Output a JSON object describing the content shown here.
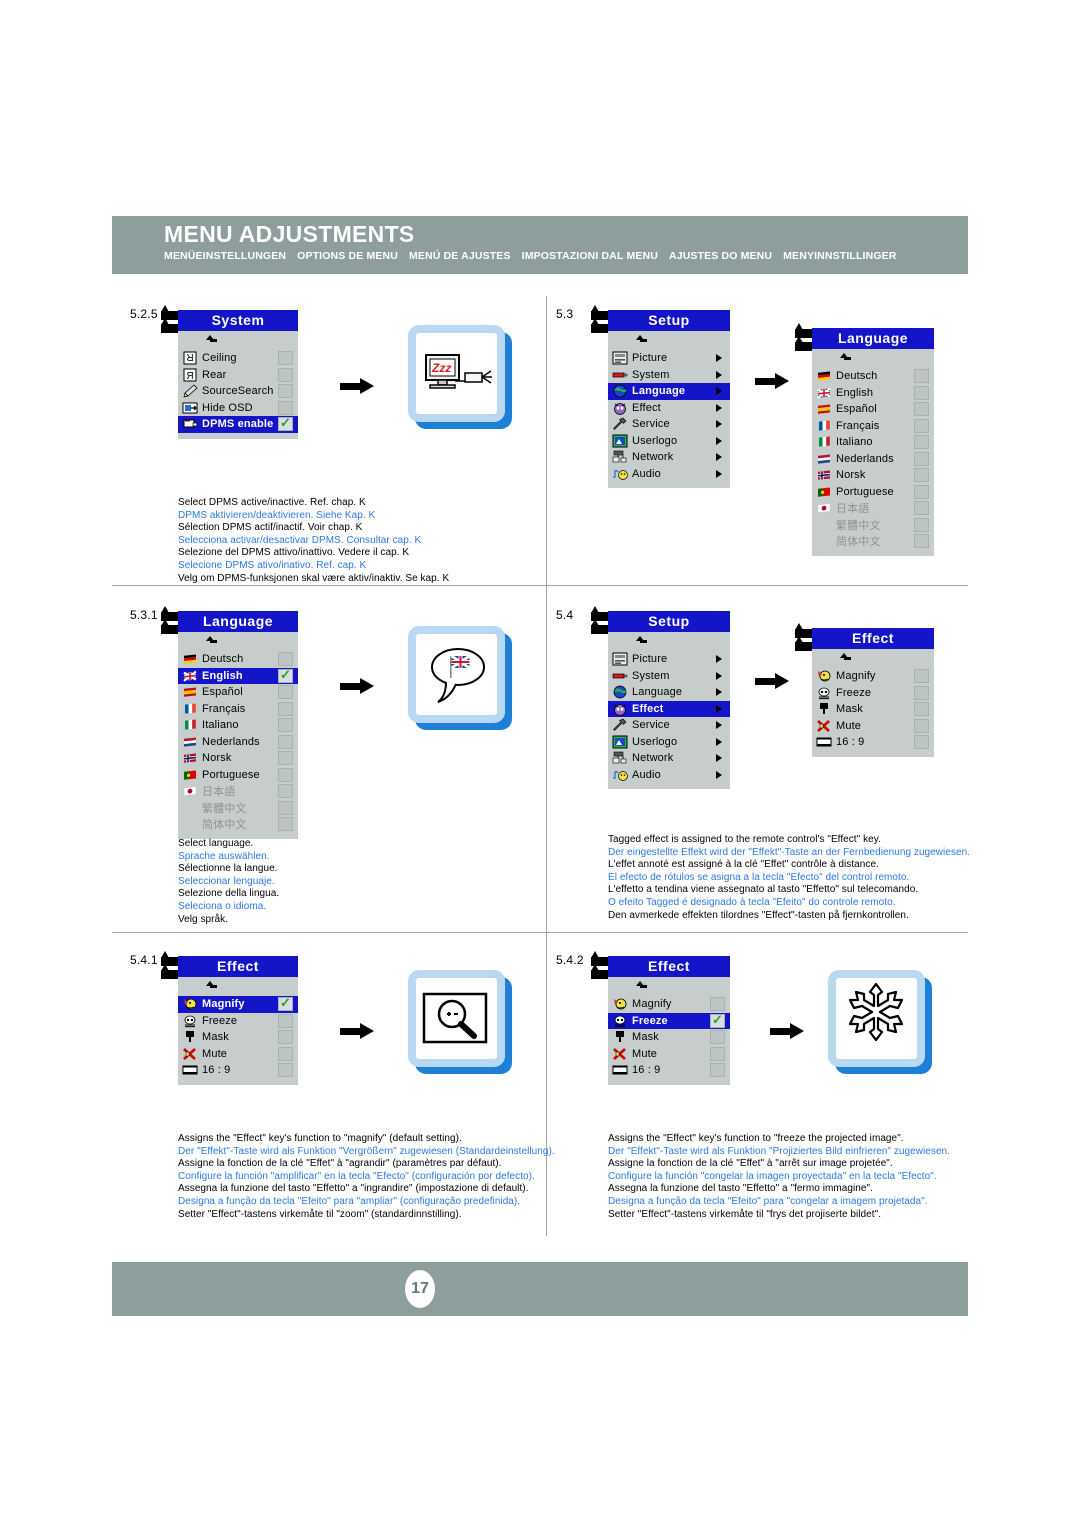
{
  "header": {
    "title": "MENU ADJUSTMENTS",
    "subtitles": [
      "MENÜEINSTELLUNGEN",
      "OPTIONS DE MENU",
      "MENÚ DE AJUSTES",
      "IMPOSTAZIONI DAL MENU",
      "AJUSTES DO MENU",
      "MENYINNSTILLINGER"
    ]
  },
  "footer": {
    "page": "17"
  },
  "colors": {
    "header_bg": "#8d9e9c",
    "osd_title_bg": "#1414c8",
    "osd_body_bg": "#c7cdcd",
    "highlight": "#1414c8",
    "check_green": "#2aa02a",
    "caption_alt": "#2b7ae0",
    "illu_frame": "#b9d9f2",
    "illu_shadow": "#1e7fd6"
  },
  "sections": [
    {
      "number": "5.2.5",
      "menu": {
        "title": "System",
        "items": [
          {
            "label": "Ceiling",
            "icon": "ceiling-icon",
            "selected": false,
            "checked": false
          },
          {
            "label": "Rear",
            "icon": "rear-icon",
            "selected": false,
            "checked": false
          },
          {
            "label": "SourceSearch",
            "icon": "sourcesearch-icon",
            "selected": false,
            "checked": false
          },
          {
            "label": "Hide OSD",
            "icon": "hide-osd-icon",
            "selected": false,
            "checked": false
          },
          {
            "label": "DPMS enable",
            "icon": "dpms-icon",
            "selected": true,
            "checked": true
          }
        ]
      },
      "illustration": "monitor-sleep-zzz",
      "caption": [
        {
          "text": "Select DPMS active/inactive. Ref. chap. K",
          "alt": false
        },
        {
          "text": "DPMS aktivieren/deaktivieren. Siehe Kap. K",
          "alt": true
        },
        {
          "text": "Sélection DPMS actif/inactif. Voir chap. K",
          "alt": false
        },
        {
          "text": "Selecciona activar/desactivar DPMS. Consultar cap. K",
          "alt": true
        },
        {
          "text": "Selezione del DPMS attivo/inattivo. Vedere il cap. K",
          "alt": false
        },
        {
          "text": "Selecione DPMS ativo/inativo. Ref. cap. K",
          "alt": true
        },
        {
          "text": "Velg om DPMS-funksjonen skal være aktiv/inaktiv. Se kap. K",
          "alt": false
        }
      ]
    },
    {
      "number": "5.3",
      "menu": {
        "title": "Setup",
        "items": [
          {
            "label": "Picture",
            "icon": "picture-icon",
            "selected": false,
            "submenu": true
          },
          {
            "label": "System",
            "icon": "system-icon",
            "selected": false,
            "submenu": true
          },
          {
            "label": "Language",
            "icon": "language-icon",
            "selected": true,
            "submenu": true
          },
          {
            "label": "Effect",
            "icon": "effect-icon",
            "selected": false,
            "submenu": true
          },
          {
            "label": "Service",
            "icon": "service-icon",
            "selected": false,
            "submenu": true
          },
          {
            "label": "Userlogo",
            "icon": "userlogo-icon",
            "selected": false,
            "submenu": true
          },
          {
            "label": "Network",
            "icon": "network-icon",
            "selected": false,
            "submenu": true
          },
          {
            "label": "Audio",
            "icon": "audio-icon",
            "selected": false,
            "submenu": true
          }
        ]
      },
      "submenu": {
        "title": "Language",
        "items": [
          {
            "label": "Deutsch",
            "icon": "flag-de",
            "selected": false,
            "checked": false,
            "dim": false
          },
          {
            "label": "English",
            "icon": "flag-gb",
            "selected": false,
            "checked": false,
            "dim": false
          },
          {
            "label": "Español",
            "icon": "flag-es",
            "selected": false,
            "checked": false,
            "dim": false
          },
          {
            "label": "Français",
            "icon": "flag-fr",
            "selected": false,
            "checked": false,
            "dim": false
          },
          {
            "label": "Italiano",
            "icon": "flag-it",
            "selected": false,
            "checked": false,
            "dim": false
          },
          {
            "label": "Nederlands",
            "icon": "flag-nl",
            "selected": false,
            "checked": false,
            "dim": false
          },
          {
            "label": "Norsk",
            "icon": "flag-no",
            "selected": false,
            "checked": false,
            "dim": false
          },
          {
            "label": "Portuguese",
            "icon": "flag-pt",
            "selected": false,
            "checked": false,
            "dim": false
          },
          {
            "label": "日本語",
            "icon": "flag-jp",
            "selected": false,
            "checked": false,
            "dim": true
          },
          {
            "label": "繁體中文",
            "icon": "none",
            "selected": false,
            "checked": false,
            "dim": true
          },
          {
            "label": "简体中文",
            "icon": "none",
            "selected": false,
            "checked": false,
            "dim": true
          }
        ]
      },
      "caption": []
    },
    {
      "number": "5.3.1",
      "menu": {
        "title": "Language",
        "items": [
          {
            "label": "Deutsch",
            "icon": "flag-de",
            "selected": false,
            "checked": false,
            "dim": false
          },
          {
            "label": "English",
            "icon": "flag-gb",
            "selected": true,
            "checked": true,
            "dim": false
          },
          {
            "label": "Español",
            "icon": "flag-es",
            "selected": false,
            "checked": false,
            "dim": false
          },
          {
            "label": "Français",
            "icon": "flag-fr",
            "selected": false,
            "checked": false,
            "dim": false
          },
          {
            "label": "Italiano",
            "icon": "flag-it",
            "selected": false,
            "checked": false,
            "dim": false
          },
          {
            "label": "Nederlands",
            "icon": "flag-nl",
            "selected": false,
            "checked": false,
            "dim": false
          },
          {
            "label": "Norsk",
            "icon": "flag-no",
            "selected": false,
            "checked": false,
            "dim": false
          },
          {
            "label": "Portuguese",
            "icon": "flag-pt",
            "selected": false,
            "checked": false,
            "dim": false
          },
          {
            "label": "日本語",
            "icon": "flag-jp",
            "selected": false,
            "checked": false,
            "dim": true
          },
          {
            "label": "繁體中文",
            "icon": "none",
            "selected": false,
            "checked": false,
            "dim": true
          },
          {
            "label": "简体中文",
            "icon": "none",
            "selected": false,
            "checked": false,
            "dim": true
          }
        ]
      },
      "illustration": "speech-bubble-uk-flag",
      "caption": [
        {
          "text": "Select language.",
          "alt": false
        },
        {
          "text": "Sprache auswählen.",
          "alt": true
        },
        {
          "text": "Sélectionne la langue.",
          "alt": false
        },
        {
          "text": "Seleccionar lenguaje.",
          "alt": true
        },
        {
          "text": "Selezione della lingua.",
          "alt": false
        },
        {
          "text": "Seleciona o idioma.",
          "alt": true
        },
        {
          "text": "Velg språk.",
          "alt": false
        }
      ]
    },
    {
      "number": "5.4",
      "menu": {
        "title": "Setup",
        "items": [
          {
            "label": "Picture",
            "icon": "picture-icon",
            "selected": false,
            "submenu": true
          },
          {
            "label": "System",
            "icon": "system-icon",
            "selected": false,
            "submenu": true
          },
          {
            "label": "Language",
            "icon": "language-icon",
            "selected": false,
            "submenu": true
          },
          {
            "label": "Effect",
            "icon": "effect-icon",
            "selected": true,
            "submenu": true
          },
          {
            "label": "Service",
            "icon": "service-icon",
            "selected": false,
            "submenu": true
          },
          {
            "label": "Userlogo",
            "icon": "userlogo-icon",
            "selected": false,
            "submenu": true
          },
          {
            "label": "Network",
            "icon": "network-icon",
            "selected": false,
            "submenu": true
          },
          {
            "label": "Audio",
            "icon": "audio-icon",
            "selected": false,
            "submenu": true
          }
        ]
      },
      "submenu": {
        "title": "Effect",
        "items": [
          {
            "label": "Magnify",
            "icon": "magnify-icon",
            "selected": false,
            "checked": false
          },
          {
            "label": "Freeze",
            "icon": "freeze-icon",
            "selected": false,
            "checked": false
          },
          {
            "label": "Mask",
            "icon": "mask-icon",
            "selected": false,
            "checked": false
          },
          {
            "label": "Mute",
            "icon": "mute-icon",
            "selected": false,
            "checked": false
          },
          {
            "label": "16 : 9",
            "icon": "wide-icon",
            "selected": false,
            "checked": false
          }
        ]
      },
      "caption": [
        {
          "text": "Tagged effect is assigned to the remote control's \"Effect\" key.",
          "alt": false
        },
        {
          "text": "Der eingestellte Effekt wird der \"Effekt\"-Taste an der Fernbedienung zugewiesen.",
          "alt": true
        },
        {
          "text": "L'effet annoté est assigné à la clé \"Effet\" contrôle à distance.",
          "alt": false
        },
        {
          "text": "El efecto de rótulos se asigna a la tecla \"Efecto\" del control remoto.",
          "alt": true
        },
        {
          "text": "L'effetto a tendina viene assegnato al tasto \"Effetto\" sul telecomando.",
          "alt": false
        },
        {
          "text": "O efeito Tagged é designado à tecla \"Efeito\" do controle remoto.",
          "alt": true
        },
        {
          "text": "Den avmerkede effekten tilordnes \"Effect\"-tasten på  fjernkontrollen.",
          "alt": false
        }
      ]
    },
    {
      "number": "5.4.1",
      "menu": {
        "title": "Effect",
        "items": [
          {
            "label": "Magnify",
            "icon": "magnify-icon",
            "selected": true,
            "checked": true
          },
          {
            "label": "Freeze",
            "icon": "freeze-icon",
            "selected": false,
            "checked": false
          },
          {
            "label": "Mask",
            "icon": "mask-icon",
            "selected": false,
            "checked": false
          },
          {
            "label": "Mute",
            "icon": "mute-icon",
            "selected": false,
            "checked": false
          },
          {
            "label": "16 : 9",
            "icon": "wide-icon",
            "selected": false,
            "checked": false
          }
        ]
      },
      "illustration": "magnifier-plus-minus",
      "caption": [
        {
          "text": "Assigns the \"Effect\" key's function to \"magnify\" (default setting).",
          "alt": false
        },
        {
          "text": "Der \"Effekt\"-Taste wird als Funktion \"Vergrößern\" zugewiesen (Standardeinstellung).",
          "alt": true
        },
        {
          "text": "Assigne la fonction de la clé \"Effet\" à \"agrandir\" (paramètres par défaut).",
          "alt": false
        },
        {
          "text": "Configure la función \"amplificar\" en la tecla \"Efecto\" (configuración por defecto).",
          "alt": true
        },
        {
          "text": "Assegna la funzione del tasto \"Effetto\" a \"ingrandire\" (impostazione di default).",
          "alt": false
        },
        {
          "text": "Designa a função da tecla \"Efeito\" para \"ampliar\" (configuração predefinida).",
          "alt": true
        },
        {
          "text": "Setter \"Effect\"-tastens virkemåte til \"zoom\" (standardinnstilling).",
          "alt": false
        }
      ]
    },
    {
      "number": "5.4.2",
      "menu": {
        "title": "Effect",
        "items": [
          {
            "label": "Magnify",
            "icon": "magnify-icon",
            "selected": false,
            "checked": false
          },
          {
            "label": "Freeze",
            "icon": "freeze-icon",
            "selected": true,
            "checked": true
          },
          {
            "label": "Mask",
            "icon": "mask-icon",
            "selected": false,
            "checked": false
          },
          {
            "label": "Mute",
            "icon": "mute-icon",
            "selected": false,
            "checked": false
          },
          {
            "label": "16 : 9",
            "icon": "wide-icon",
            "selected": false,
            "checked": false
          }
        ]
      },
      "illustration": "snowflake",
      "caption": [
        {
          "text": "Assigns the \"Effect\" key's function to \"freeze the projected image\".",
          "alt": false
        },
        {
          "text": "Der \"Effekt\"-Taste wird als Funktion \"Projiziertes Bild einfrieren\" zugewiesen.",
          "alt": true
        },
        {
          "text": "Assigne la fonction de la clé \"Effet\" à \"arrêt sur image projetée\".",
          "alt": false
        },
        {
          "text": "Configure la función \"congelar la imagen proyectada\" en la tecla \"Efecto\".",
          "alt": true
        },
        {
          "text": "Assegna la funzione del tasto \"Effetto\" a \"fermo immagine\".",
          "alt": false
        },
        {
          "text": "Designa a função da tecla \"Efeito\" para \"congelar a imagem projetada\".",
          "alt": true
        },
        {
          "text": "Setter \"Effect\"-tastens virkemåte til \"frys det projiserte bildet\".",
          "alt": false
        }
      ]
    }
  ]
}
